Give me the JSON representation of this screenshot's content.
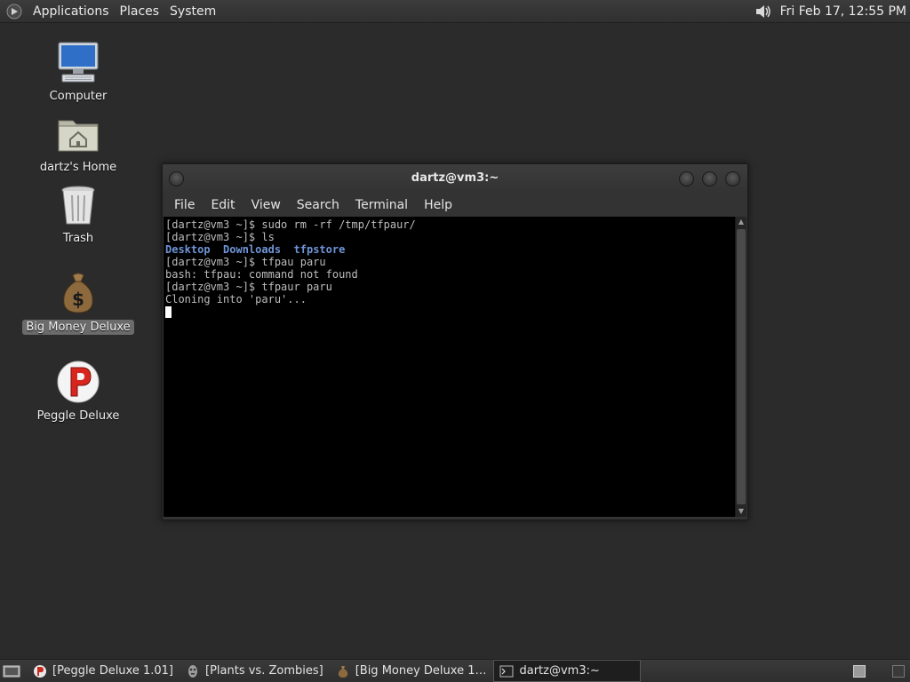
{
  "top_panel": {
    "menus": [
      "Applications",
      "Places",
      "System"
    ],
    "clock": "Fri Feb 17, 12:55 PM"
  },
  "desktop": {
    "icons": [
      {
        "label": "Computer",
        "icon": "computer-icon"
      },
      {
        "label": "dartz's Home",
        "icon": "home-folder-icon"
      },
      {
        "label": "Trash",
        "icon": "trash-icon"
      },
      {
        "label": "Big Money Deluxe",
        "icon": "money-bag-icon",
        "selected": true
      },
      {
        "label": "Peggle Deluxe",
        "icon": "peggle-icon"
      }
    ]
  },
  "terminal": {
    "title": "dartz@vm3:~",
    "menus": [
      "File",
      "Edit",
      "View",
      "Search",
      "Terminal",
      "Help"
    ],
    "lines": [
      "[dartz@vm3 ~]$ sudo rm -rf /tmp/tfpaur/",
      "[dartz@vm3 ~]$ ls",
      "",
      "[dartz@vm3 ~]$ tfpau paru",
      "bash: tfpau: command not found",
      "[dartz@vm3 ~]$ tfpaur paru",
      "Cloning into 'paru'..."
    ],
    "ls_output": [
      "Desktop",
      "Downloads",
      "tfpstore"
    ],
    "ls_color": "#6f95d8"
  },
  "taskbar": {
    "tasks": [
      {
        "label": "[Peggle Deluxe 1.01]",
        "icon": "peggle-icon"
      },
      {
        "label": "[Plants vs. Zombies]",
        "icon": "zombie-icon"
      },
      {
        "label": "[Big Money Deluxe 1…",
        "icon": "money-bag-icon"
      },
      {
        "label": "dartz@vm3:~",
        "icon": "terminal-icon",
        "active": true
      }
    ]
  }
}
